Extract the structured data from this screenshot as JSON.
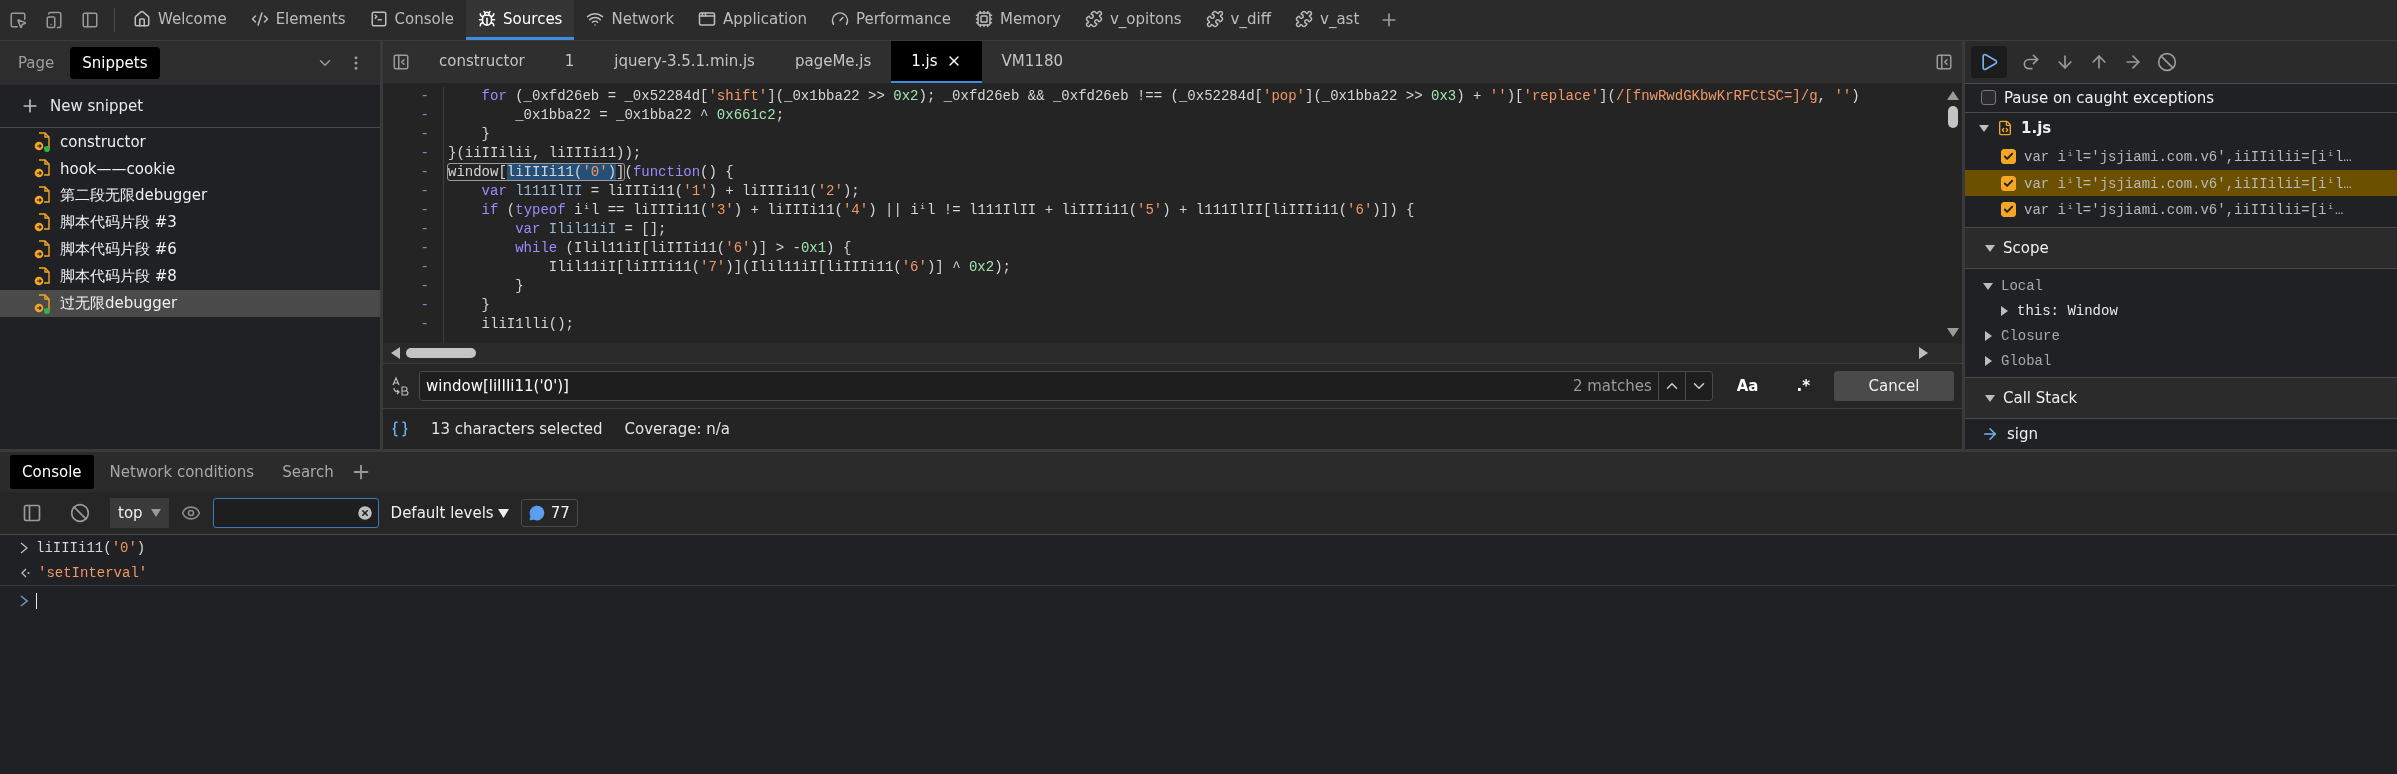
{
  "toolbar": {
    "tabs": [
      {
        "label": "Welcome",
        "selected": false
      },
      {
        "label": "Elements",
        "selected": false
      },
      {
        "label": "Console",
        "selected": false
      },
      {
        "label": "Sources",
        "selected": true
      },
      {
        "label": "Network",
        "selected": false
      },
      {
        "label": "Application",
        "selected": false
      },
      {
        "label": "Performance",
        "selected": false
      },
      {
        "label": "Memory",
        "selected": false
      },
      {
        "label": "v_opitons",
        "selected": false
      },
      {
        "label": "v_diff",
        "selected": false
      },
      {
        "label": "v_ast",
        "selected": false
      }
    ]
  },
  "navigator": {
    "tabs": [
      {
        "label": "Page",
        "selected": false
      },
      {
        "label": "Snippets",
        "selected": true
      }
    ],
    "new_snippet": "New snippet",
    "snippets": [
      {
        "name": "constructor",
        "running": true,
        "selected": false
      },
      {
        "name": "hook——cookie",
        "running": false,
        "selected": false
      },
      {
        "name": "第二段无限debugger",
        "running": false,
        "selected": false
      },
      {
        "name": "脚本代码片段 #3",
        "running": false,
        "selected": false
      },
      {
        "name": "脚本代码片段 #6",
        "running": false,
        "selected": false
      },
      {
        "name": "脚本代码片段 #8",
        "running": false,
        "selected": false
      },
      {
        "name": "过无限debugger",
        "running": true,
        "selected": true
      }
    ]
  },
  "editor": {
    "tabs": [
      {
        "label": "constructor",
        "selected": false
      },
      {
        "label": "1",
        "selected": false
      },
      {
        "label": "jquery-3.5.1.min.js",
        "selected": false
      },
      {
        "label": "pageMe.js",
        "selected": false
      },
      {
        "label": "1.js",
        "selected": true
      },
      {
        "label": "VM1180",
        "selected": false
      }
    ],
    "lines": [
      {
        "gutter": "-",
        "tokens": [
          {
            "kind": "keyword",
            "text": "    for"
          },
          {
            "kind": "plain",
            "text": " (_0xfd26eb = _0x52284d["
          },
          {
            "kind": "string",
            "text": "'shift'"
          },
          {
            "kind": "plain",
            "text": "](_0x1bba22 >> "
          },
          {
            "kind": "number",
            "text": "0x2"
          },
          {
            "kind": "plain",
            "text": "); _0xfd26eb && _0xfd26eb !== (_0x52284d["
          },
          {
            "kind": "string",
            "text": "'pop'"
          },
          {
            "kind": "plain",
            "text": "](_0x1bba22 >> "
          },
          {
            "kind": "number",
            "text": "0x3"
          },
          {
            "kind": "plain",
            "text": ") + "
          },
          {
            "kind": "string",
            "text": "''"
          },
          {
            "kind": "plain",
            "text": ")["
          },
          {
            "kind": "string",
            "text": "'replace'"
          },
          {
            "kind": "plain",
            "text": "]("
          },
          {
            "kind": "string",
            "text": "/[fnwRwdGKbwKrRFCtSC=]/g"
          },
          {
            "kind": "plain",
            "text": ", "
          },
          {
            "kind": "string",
            "text": "''"
          },
          {
            "kind": "plain",
            "text": ")"
          }
        ]
      },
      {
        "gutter": "-",
        "tokens": [
          {
            "kind": "plain",
            "text": "        _0x1bba22 = _0x1bba22 ^ "
          },
          {
            "kind": "number",
            "text": "0x661c2"
          },
          {
            "kind": "plain",
            "text": ";"
          }
        ]
      },
      {
        "gutter": "-",
        "tokens": [
          {
            "kind": "plain",
            "text": "    }"
          }
        ]
      },
      {
        "gutter": "-",
        "tokens": [
          {
            "kind": "plain",
            "text": "}(iiIIilii, liIIIi11));"
          }
        ]
      },
      {
        "gutter": "-",
        "tokens": [
          {
            "kind": "match",
            "children": [
              {
                "kind": "plain",
                "text": "window[",
                "selected": false
              },
              {
                "kind": "plain",
                "text": "liIIIi11(",
                "selected": true
              },
              {
                "kind": "string",
                "text": "'0'",
                "selected": true
              },
              {
                "kind": "plain",
                "text": ")",
                "selected": true
              },
              {
                "kind": "plain",
                "text": "]",
                "selected": false
              }
            ]
          },
          {
            "kind": "plain",
            "text": "("
          },
          {
            "kind": "keyword",
            "text": "function"
          },
          {
            "kind": "plain",
            "text": "() {"
          }
        ]
      },
      {
        "gutter": "-",
        "tokens": [
          {
            "kind": "keyword",
            "text": "    var "
          },
          {
            "kind": "definition",
            "text": "l111IlII"
          },
          {
            "kind": "plain",
            "text": " = liIIIi11("
          },
          {
            "kind": "string",
            "text": "'1'"
          },
          {
            "kind": "plain",
            "text": ") + liIIIi11("
          },
          {
            "kind": "string",
            "text": "'2'"
          },
          {
            "kind": "plain",
            "text": ");"
          }
        ]
      },
      {
        "gutter": "-",
        "tokens": [
          {
            "kind": "keyword",
            "text": "    if"
          },
          {
            "kind": "plain",
            "text": " ("
          },
          {
            "kind": "keyword",
            "text": "typeof"
          },
          {
            "kind": "plain",
            "text": " iⁱl == liIIIi11("
          },
          {
            "kind": "string",
            "text": "'3'"
          },
          {
            "kind": "plain",
            "text": ") + liIIIi11("
          },
          {
            "kind": "string",
            "text": "'4'"
          },
          {
            "kind": "plain",
            "text": ") || iⁱl != l111IlII + liIIIi11("
          },
          {
            "kind": "string",
            "text": "'5'"
          },
          {
            "kind": "plain",
            "text": ") + l111IlII[liIIIi11("
          },
          {
            "kind": "string",
            "text": "'6'"
          },
          {
            "kind": "plain",
            "text": ")]) {"
          }
        ]
      },
      {
        "gutter": "-",
        "tokens": [
          {
            "kind": "keyword",
            "text": "        var "
          },
          {
            "kind": "definition",
            "text": "Ilil11iI"
          },
          {
            "kind": "plain",
            "text": " = [];"
          }
        ]
      },
      {
        "gutter": "-",
        "tokens": [
          {
            "kind": "keyword",
            "text": "        while"
          },
          {
            "kind": "plain",
            "text": " (Ilil11iI[liIIIi11("
          },
          {
            "kind": "string",
            "text": "'6'"
          },
          {
            "kind": "plain",
            "text": ")] > -"
          },
          {
            "kind": "number",
            "text": "0x1"
          },
          {
            "kind": "plain",
            "text": ") {"
          }
        ]
      },
      {
        "gutter": "-",
        "tokens": [
          {
            "kind": "plain",
            "text": "            Ilil11iI[liIIIi11("
          },
          {
            "kind": "string",
            "text": "'7'"
          },
          {
            "kind": "plain",
            "text": ")](Ilil11iI[liIIIi11("
          },
          {
            "kind": "string",
            "text": "'6'"
          },
          {
            "kind": "plain",
            "text": ")] ^ "
          },
          {
            "kind": "number",
            "text": "0x2"
          },
          {
            "kind": "plain",
            "text": ");"
          }
        ]
      },
      {
        "gutter": "-",
        "tokens": [
          {
            "kind": "plain",
            "text": "        }"
          }
        ]
      },
      {
        "gutter": "-",
        "tokens": [
          {
            "kind": "plain",
            "text": "    }"
          }
        ]
      },
      {
        "gutter": "-",
        "tokens": [
          {
            "kind": "plain",
            "text": "    iliI1lli();"
          }
        ]
      }
    ],
    "search": {
      "value": "window[liIIIi11('0')]",
      "matches": "2 matches",
      "case_toggle": "Aa",
      "regex_toggle": ".*",
      "cancel": "Cancel"
    },
    "status": {
      "selection": "13 characters selected",
      "coverage": "Coverage: n/a"
    }
  },
  "debugger": {
    "pause_on_caught": {
      "label": "Pause on caught exceptions",
      "checked": false
    },
    "breakpoints": {
      "file": "1.js",
      "expanded": true,
      "items": [
        {
          "text": "var iⁱl='jsjiami.com.v6',iiIIilii=[iⁱl…",
          "checked": true,
          "selected": false
        },
        {
          "text": "var iⁱl='jsjiami.com.v6',iiIIilii=[iⁱl…",
          "checked": true,
          "selected": true
        },
        {
          "text": "var iⁱl='jsjiami.com.v6',iiIIilii=[iⁱ…",
          "checked": true,
          "selected": false
        }
      ]
    },
    "scope": {
      "title": "Scope",
      "expanded": true,
      "items": [
        {
          "label": "Local",
          "expanded": true,
          "children": [
            {
              "label": "this: Window",
              "expanded": false
            }
          ]
        },
        {
          "label": "Closure",
          "expanded": false
        },
        {
          "label": "Global",
          "expanded": false
        }
      ]
    },
    "call_stack": {
      "title": "Call Stack",
      "expanded": true,
      "frames": [
        {
          "name": "sign",
          "selected": true
        }
      ]
    }
  },
  "drawer": {
    "tabs": [
      {
        "label": "Console",
        "selected": true
      },
      {
        "label": "Network conditions",
        "selected": false
      },
      {
        "label": "Search",
        "selected": false
      }
    ],
    "context": "top",
    "levels": "Default levels",
    "message_count": "77",
    "entries": [
      {
        "kind": "input",
        "tokens": [
          {
            "kind": "plain",
            "text": "liIIIi11("
          },
          {
            "kind": "string",
            "text": "'0'"
          },
          {
            "kind": "plain",
            "text": ")"
          }
        ]
      },
      {
        "kind": "output",
        "tokens": [
          {
            "kind": "string",
            "text": "'setInterval'"
          }
        ]
      },
      {
        "kind": "prompt"
      }
    ]
  }
}
